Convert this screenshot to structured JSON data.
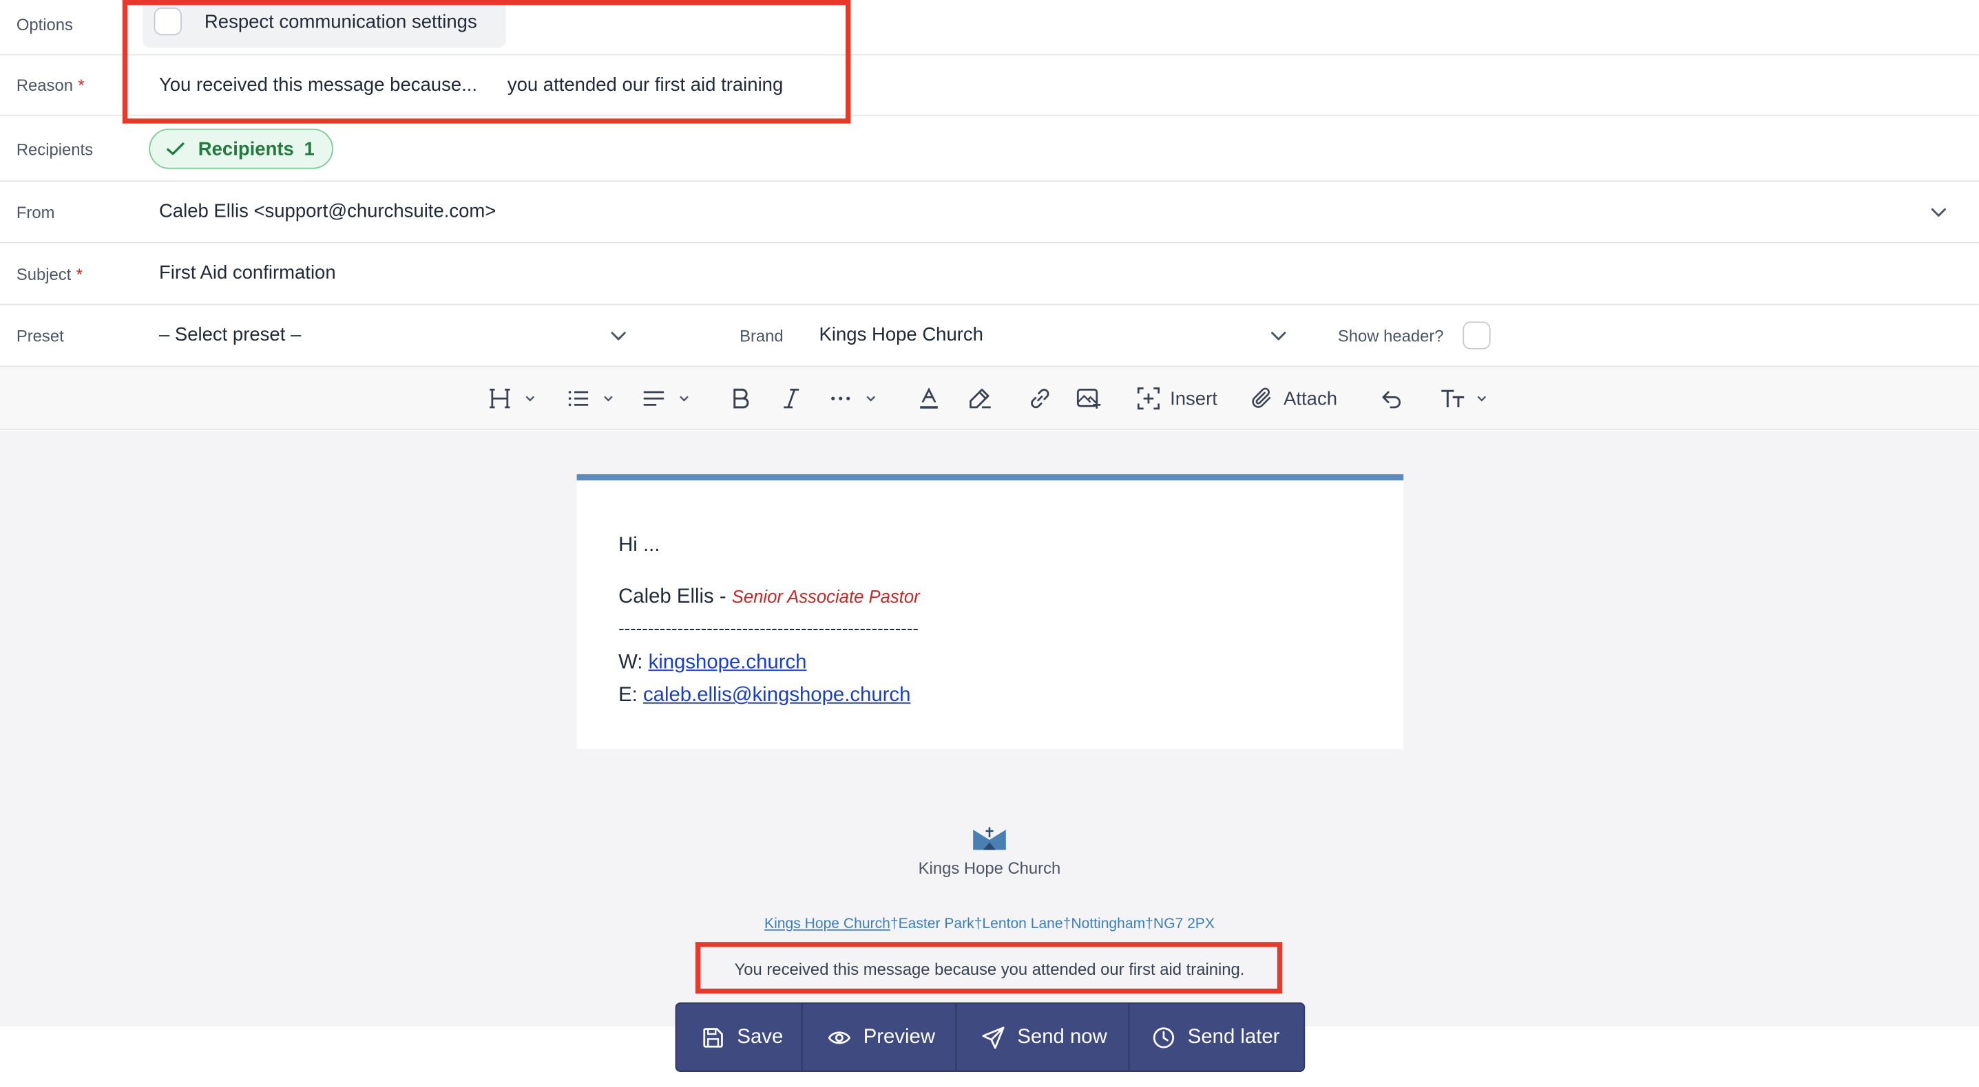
{
  "form": {
    "options": {
      "label": "Options",
      "checkbox_label": "Respect communication settings",
      "checked": false
    },
    "reason": {
      "label": "Reason",
      "required_mark": "*",
      "prefix": "You received this message because...",
      "value": "you attended our first aid training"
    },
    "recipients": {
      "label": "Recipients",
      "pill_label": "Recipients",
      "count": "1"
    },
    "from": {
      "label": "From",
      "value": "Caleb Ellis <support@churchsuite.com>"
    },
    "subject": {
      "label": "Subject",
      "required_mark": "*",
      "value": "First Aid confirmation"
    },
    "preset": {
      "label": "Preset",
      "value": "– Select preset –"
    },
    "brand": {
      "label": "Brand",
      "value": "Kings Hope Church"
    },
    "show_header": {
      "label": "Show header?",
      "checked": false
    }
  },
  "toolbar": {
    "heading_icon": "heading-icon",
    "insert_label": "Insert",
    "attach_label": "Attach"
  },
  "email": {
    "greeting": "Hi ...",
    "sender_name": "Caleb Ellis",
    "sender_sep": " - ",
    "sender_role": "Senior Associate Pastor",
    "divider": "---------------------------------------------------",
    "web_prefix": "W: ",
    "web_link": "kingshope.church",
    "email_prefix": "E: ",
    "email_link": "caleb.ellis@kingshope.church",
    "accent_color": "#5a8cc0"
  },
  "footer": {
    "org_name": "Kings Hope Church",
    "address_link": "Kings Hope Church",
    "address_rest": "†Easter Park†Lenton Lane†Nottingham†NG7 2PX",
    "reason_text": "You received this message because you attended our first aid training."
  },
  "actions": {
    "save": "Save",
    "preview": "Preview",
    "send_now": "Send now",
    "send_later": "Send later",
    "bar_color": "#3e4a80"
  },
  "highlight_color": "#e53a2b"
}
